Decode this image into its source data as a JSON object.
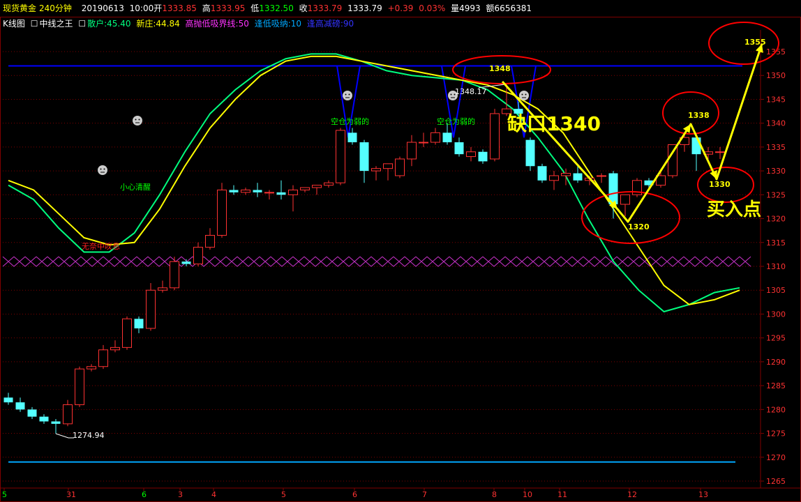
{
  "header": {
    "instrument": "现货黄金",
    "period": "240分钟",
    "date": "20190613",
    "time": "10:00",
    "open_label": "开",
    "open": "1333.85",
    "high_label": "高",
    "high": "1333.95",
    "low_label": "低",
    "low": "1332.50",
    "close_label": "收",
    "close": "1333.79",
    "last": "1333.79",
    "change": "+0.39",
    "change_pct": "0.03%",
    "volume_label": "量",
    "volume": "4993",
    "amount_label": "额",
    "amount": "6656381"
  },
  "indicator_bar": {
    "kline_label": "K线图",
    "indicator_name": "中线之王",
    "retail_label": "散户:45.40",
    "dealer_label": "新庄:44.84",
    "high_sell_label": "高抛低吸界线:50",
    "low_buy_label": "逢低吸纳:10",
    "high_reduce_label": "逢高减磅:90"
  },
  "colors": {
    "bg": "#000000",
    "up": "#ff3232",
    "down": "#54ffff",
    "grid": "#800000",
    "axis_text": "#ff3232",
    "yellow": "#ffff00",
    "green_line": "#00ff7f",
    "blue_line": "#0000ff",
    "cyan_line": "#00a8ff",
    "magenta": "#cc33cc",
    "red_circle": "#ff0000"
  },
  "chart_data": {
    "type": "candlestick",
    "ylim": [
      1265,
      1362
    ],
    "y_ticks": [
      1265,
      1270,
      1275,
      1280,
      1285,
      1290,
      1295,
      1300,
      1305,
      1310,
      1315,
      1320,
      1325,
      1330,
      1335,
      1340,
      1345,
      1350,
      1355
    ],
    "x_labels": [
      "5",
      "31",
      "6",
      "3",
      "4",
      "5",
      "6",
      "7",
      "8",
      "10",
      "11",
      "12",
      "13"
    ],
    "candles": [
      {
        "o": 1282.5,
        "h": 1283.5,
        "l": 1281,
        "c": 1281.5
      },
      {
        "o": 1281.5,
        "h": 1282.5,
        "l": 1279.5,
        "c": 1280
      },
      {
        "o": 1280,
        "h": 1280.5,
        "l": 1278,
        "c": 1278.5
      },
      {
        "o": 1278.5,
        "h": 1279,
        "l": 1277,
        "c": 1277.5
      },
      {
        "o": 1277.5,
        "h": 1278,
        "l": 1274.94,
        "c": 1277
      },
      {
        "o": 1277,
        "h": 1282,
        "l": 1276.5,
        "c": 1281
      },
      {
        "o": 1281,
        "h": 1289,
        "l": 1280.5,
        "c": 1288.5
      },
      {
        "o": 1288.5,
        "h": 1289.5,
        "l": 1288,
        "c": 1289
      },
      {
        "o": 1289,
        "h": 1293.5,
        "l": 1288.5,
        "c": 1292.5
      },
      {
        "o": 1292.5,
        "h": 1294.5,
        "l": 1292,
        "c": 1293
      },
      {
        "o": 1293,
        "h": 1299.5,
        "l": 1292.5,
        "c": 1299
      },
      {
        "o": 1299,
        "h": 1299.5,
        "l": 1296,
        "c": 1297
      },
      {
        "o": 1297,
        "h": 1306.5,
        "l": 1296.5,
        "c": 1305
      },
      {
        "o": 1305,
        "h": 1307,
        "l": 1304.5,
        "c": 1305.5
      },
      {
        "o": 1305.5,
        "h": 1312,
        "l": 1305,
        "c": 1311
      },
      {
        "o": 1311,
        "h": 1311.5,
        "l": 1310,
        "c": 1310.5
      },
      {
        "o": 1310.5,
        "h": 1315,
        "l": 1310,
        "c": 1314
      },
      {
        "o": 1314,
        "h": 1318,
        "l": 1313.5,
        "c": 1316.5
      },
      {
        "o": 1316.5,
        "h": 1327.5,
        "l": 1316,
        "c": 1326
      },
      {
        "o": 1326,
        "h": 1327,
        "l": 1325,
        "c": 1325.5
      },
      {
        "o": 1325.5,
        "h": 1326.5,
        "l": 1325,
        "c": 1326
      },
      {
        "o": 1326,
        "h": 1327.5,
        "l": 1324.5,
        "c": 1325.5
      },
      {
        "o": 1325.5,
        "h": 1326,
        "l": 1324,
        "c": 1325.5
      },
      {
        "o": 1325.5,
        "h": 1328,
        "l": 1324,
        "c": 1325
      },
      {
        "o": 1325,
        "h": 1327,
        "l": 1321.5,
        "c": 1326
      },
      {
        "o": 1326,
        "h": 1326.5,
        "l": 1325.5,
        "c": 1326.5
      },
      {
        "o": 1326.5,
        "h": 1327,
        "l": 1325,
        "c": 1327
      },
      {
        "o": 1327,
        "h": 1328,
        "l": 1326.5,
        "c": 1327.5
      },
      {
        "o": 1327.5,
        "h": 1339,
        "l": 1327,
        "c": 1338.5
      },
      {
        "o": 1338,
        "h": 1339,
        "l": 1335.5,
        "c": 1336
      },
      {
        "o": 1336,
        "h": 1336.5,
        "l": 1327.5,
        "c": 1330
      },
      {
        "o": 1330,
        "h": 1331,
        "l": 1328,
        "c": 1330.5
      },
      {
        "o": 1330.5,
        "h": 1331,
        "l": 1328,
        "c": 1331.5
      },
      {
        "o": 1329,
        "h": 1333,
        "l": 1328.5,
        "c": 1332.5
      },
      {
        "o": 1332.5,
        "h": 1337.5,
        "l": 1331,
        "c": 1336
      },
      {
        "o": 1336,
        "h": 1338,
        "l": 1335,
        "c": 1336
      },
      {
        "o": 1336,
        "h": 1339,
        "l": 1335.5,
        "c": 1338
      },
      {
        "o": 1338,
        "h": 1340,
        "l": 1335.5,
        "c": 1336
      },
      {
        "o": 1336,
        "h": 1337,
        "l": 1333,
        "c": 1333.5
      },
      {
        "o": 1333,
        "h": 1335,
        "l": 1332,
        "c": 1334
      },
      {
        "o": 1334,
        "h": 1334.5,
        "l": 1331.5,
        "c": 1332
      },
      {
        "o": 1332.5,
        "h": 1343,
        "l": 1332,
        "c": 1342
      },
      {
        "o": 1342,
        "h": 1348.17,
        "l": 1341.5,
        "c": 1343
      },
      {
        "o": 1343,
        "h": 1344.5,
        "l": 1341.5,
        "c": 1342
      },
      {
        "o": 1336.5,
        "h": 1337,
        "l": 1330,
        "c": 1331
      },
      {
        "o": 1331,
        "h": 1331.5,
        "l": 1327.5,
        "c": 1328
      },
      {
        "o": 1328,
        "h": 1330,
        "l": 1326,
        "c": 1329
      },
      {
        "o": 1329,
        "h": 1330.5,
        "l": 1327,
        "c": 1329.5
      },
      {
        "o": 1329.5,
        "h": 1331,
        "l": 1327.5,
        "c": 1328
      },
      {
        "o": 1328,
        "h": 1329,
        "l": 1327,
        "c": 1328.5
      },
      {
        "o": 1329,
        "h": 1329.5,
        "l": 1327.5,
        "c": 1329
      },
      {
        "o": 1329.5,
        "h": 1330,
        "l": 1320,
        "c": 1323
      },
      {
        "o": 1323,
        "h": 1325,
        "l": 1320.5,
        "c": 1325
      },
      {
        "o": 1325,
        "h": 1328.5,
        "l": 1324.5,
        "c": 1328
      },
      {
        "o": 1328,
        "h": 1328.5,
        "l": 1326.5,
        "c": 1327
      },
      {
        "o": 1327,
        "h": 1330,
        "l": 1326.5,
        "c": 1329
      },
      {
        "o": 1329,
        "h": 1335.5,
        "l": 1328.5,
        "c": 1335.5
      },
      {
        "o": 1335.5,
        "h": 1338,
        "l": 1334,
        "c": 1337
      },
      {
        "o": 1337,
        "h": 1337.5,
        "l": 1330,
        "c": 1333.5
      },
      {
        "o": 1333.5,
        "h": 1335,
        "l": 1332.5,
        "c": 1334
      },
      {
        "o": 1333.85,
        "h": 1335,
        "l": 1332.5,
        "c": 1334
      }
    ],
    "blue_line_level": 1352,
    "cyan_line_level": 1269,
    "magenta_band_level": 1311,
    "low_mark": "1274.94",
    "high_mark": "1348.17",
    "indicator_lines": {
      "yellow": [
        1328,
        1326,
        1321,
        1316,
        1314.5,
        1315,
        1322,
        1331,
        1339,
        1345,
        1350,
        1353,
        1354,
        1354,
        1353,
        1352,
        1351,
        1350,
        1349,
        1348,
        1346,
        1343,
        1338,
        1330,
        1322,
        1314,
        1306,
        1302,
        1303,
        1305
      ],
      "green": [
        1327,
        1324,
        1318,
        1313,
        1313,
        1317,
        1325,
        1334,
        1342,
        1347,
        1351,
        1353.5,
        1354.5,
        1354.5,
        1353,
        1351,
        1350,
        1349.5,
        1349,
        1347,
        1343,
        1337,
        1330,
        1320,
        1311,
        1305,
        1300.5,
        1302,
        1304.5,
        1305.5
      ]
    }
  },
  "annotations": {
    "gap_text": "缺口1340",
    "buy_text": "买入点",
    "circle_1348": "1348",
    "circle_1355": "1355",
    "circle_1338": "1338",
    "circle_1330": "1330",
    "circle_1320": "1320",
    "label_empty_1": "空仓为弱的",
    "label_empty_2": "空仓为弱的",
    "label_wake": "小心清醒",
    "label_sigh": "无奈中叹息"
  }
}
